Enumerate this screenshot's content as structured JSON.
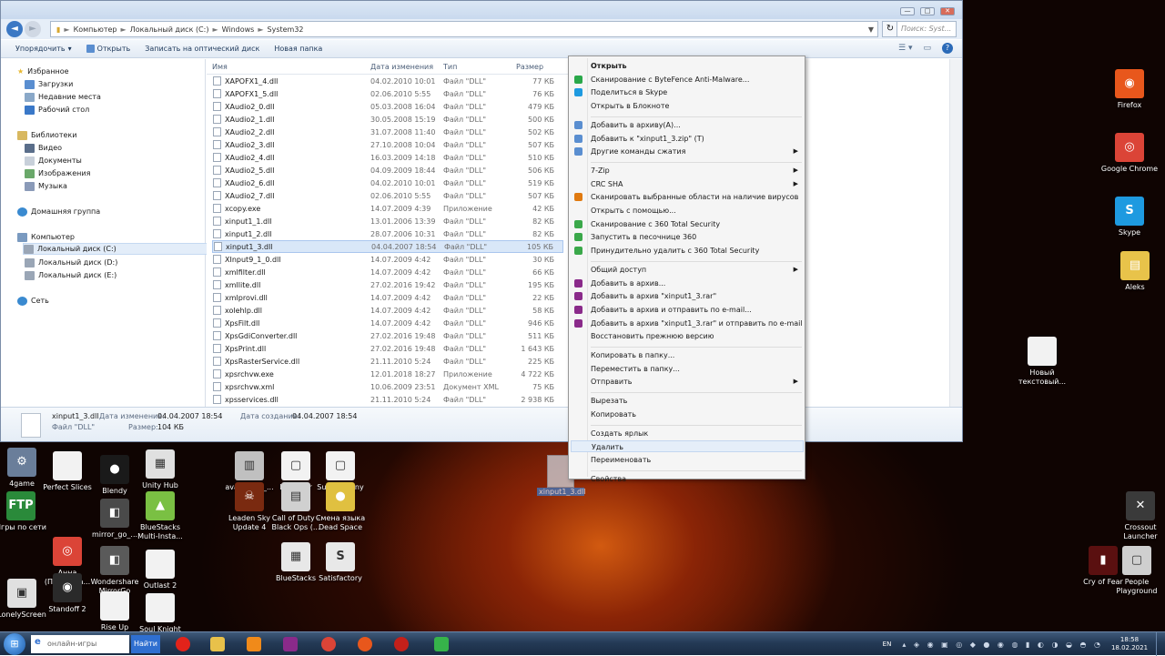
{
  "explorer": {
    "window_controls": {
      "minimize": "—",
      "maximize": "□",
      "close": "✕"
    },
    "breadcrumb": [
      "Компьютер",
      "Локальный диск (C:)",
      "Windows",
      "System32"
    ],
    "search_placeholder": "Поиск: Syst...",
    "toolbar": {
      "organize": "Упорядочить",
      "open": "Открыть",
      "burn": "Записать на оптический диск",
      "new_folder": "Новая папка"
    },
    "nav": {
      "favorites": "Избранное",
      "downloads": "Загрузки",
      "recent": "Недавние места",
      "desktop": "Рабочий стол",
      "libraries": "Библиотеки",
      "video": "Видео",
      "documents": "Документы",
      "images": "Изображения",
      "music": "Музыка",
      "homegroup": "Домашняя группа",
      "computer": "Компьютер",
      "drive_c": "Локальный диск (C:)",
      "drive_d": "Локальный диск (D:)",
      "drive_e": "Локальный диск (E:)",
      "network": "Сеть"
    },
    "columns": {
      "name": "Имя",
      "date": "Дата изменения",
      "type": "Тип",
      "size": "Размер"
    },
    "files": [
      {
        "name": "XAPOFX1_4.dll",
        "date": "04.02.2010 10:01",
        "type": "Файл \"DLL\"",
        "size": "77 КБ"
      },
      {
        "name": "XAPOFX1_5.dll",
        "date": "02.06.2010 5:55",
        "type": "Файл \"DLL\"",
        "size": "76 КБ"
      },
      {
        "name": "XAudio2_0.dll",
        "date": "05.03.2008 16:04",
        "type": "Файл \"DLL\"",
        "size": "479 КБ"
      },
      {
        "name": "XAudio2_1.dll",
        "date": "30.05.2008 15:19",
        "type": "Файл \"DLL\"",
        "size": "500 КБ"
      },
      {
        "name": "XAudio2_2.dll",
        "date": "31.07.2008 11:40",
        "type": "Файл \"DLL\"",
        "size": "502 КБ"
      },
      {
        "name": "XAudio2_3.dll",
        "date": "27.10.2008 10:04",
        "type": "Файл \"DLL\"",
        "size": "507 КБ"
      },
      {
        "name": "XAudio2_4.dll",
        "date": "16.03.2009 14:18",
        "type": "Файл \"DLL\"",
        "size": "510 КБ"
      },
      {
        "name": "XAudio2_5.dll",
        "date": "04.09.2009 18:44",
        "type": "Файл \"DLL\"",
        "size": "506 КБ"
      },
      {
        "name": "XAudio2_6.dll",
        "date": "04.02.2010 10:01",
        "type": "Файл \"DLL\"",
        "size": "519 КБ"
      },
      {
        "name": "XAudio2_7.dll",
        "date": "02.06.2010 5:55",
        "type": "Файл \"DLL\"",
        "size": "507 КБ"
      },
      {
        "name": "xcopy.exe",
        "date": "14.07.2009 4:39",
        "type": "Приложение",
        "size": "42 КБ"
      },
      {
        "name": "xinput1_1.dll",
        "date": "13.01.2006 13:39",
        "type": "Файл \"DLL\"",
        "size": "82 КБ"
      },
      {
        "name": "xinput1_2.dll",
        "date": "28.07.2006 10:31",
        "type": "Файл \"DLL\"",
        "size": "82 КБ"
      },
      {
        "name": "xinput1_3.dll",
        "date": "04.04.2007 18:54",
        "type": "Файл \"DLL\"",
        "size": "105 КБ",
        "selected": true
      },
      {
        "name": "XInput9_1_0.dll",
        "date": "14.07.2009 4:42",
        "type": "Файл \"DLL\"",
        "size": "30 КБ"
      },
      {
        "name": "xmlfilter.dll",
        "date": "14.07.2009 4:42",
        "type": "Файл \"DLL\"",
        "size": "66 КБ"
      },
      {
        "name": "xmllite.dll",
        "date": "27.02.2016 19:42",
        "type": "Файл \"DLL\"",
        "size": "195 КБ"
      },
      {
        "name": "xmlprovi.dll",
        "date": "14.07.2009 4:42",
        "type": "Файл \"DLL\"",
        "size": "22 КБ"
      },
      {
        "name": "xolehlp.dll",
        "date": "14.07.2009 4:42",
        "type": "Файл \"DLL\"",
        "size": "58 КБ"
      },
      {
        "name": "XpsFilt.dll",
        "date": "14.07.2009 4:42",
        "type": "Файл \"DLL\"",
        "size": "946 КБ"
      },
      {
        "name": "XpsGdiConverter.dll",
        "date": "27.02.2016 19:48",
        "type": "Файл \"DLL\"",
        "size": "511 КБ"
      },
      {
        "name": "XpsPrint.dll",
        "date": "27.02.2016 19:48",
        "type": "Файл \"DLL\"",
        "size": "1 643 КБ"
      },
      {
        "name": "XpsRasterService.dll",
        "date": "21.11.2010 5:24",
        "type": "Файл \"DLL\"",
        "size": "225 КБ"
      },
      {
        "name": "xpsrchvw.exe",
        "date": "12.01.2018 18:27",
        "type": "Приложение",
        "size": "4 722 КБ"
      },
      {
        "name": "xpsrchvw.xml",
        "date": "10.06.2009 23:51",
        "type": "Документ XML",
        "size": "75 КБ"
      },
      {
        "name": "xpsservices.dll",
        "date": "21.11.2010 5:24",
        "type": "Файл \"DLL\"",
        "size": "2 938 КБ"
      }
    ],
    "details": {
      "filename": "xinput1_3.dll",
      "filetype": "Файл \"DLL\"",
      "modified_label": "Дата изменения:",
      "modified_value": "04.04.2007 18:54",
      "size_label": "Размер:",
      "size_value": "104 КБ",
      "created_label": "Дата создания:",
      "created_value": "04.04.2007 18:54"
    }
  },
  "context_menu": [
    {
      "label": "Открыть",
      "bold": true
    },
    {
      "label": "Сканирование с ByteFence Anti-Malware...",
      "icon_color": "#2aa84a"
    },
    {
      "label": "Поделиться в Skype",
      "icon_color": "#1e9ae0"
    },
    {
      "label": "Открыть в Блокноте"
    },
    {
      "sep": true
    },
    {
      "label": "Добавить в архиву(A)...",
      "icon_color": "#5a8ed0"
    },
    {
      "label": "Добавить к \"xinput1_3.zip\" (T)",
      "icon_color": "#5a8ed0"
    },
    {
      "label": "Другие команды сжатия",
      "icon_color": "#5a8ed0",
      "submenu": true
    },
    {
      "sep": true
    },
    {
      "label": "7-Zip",
      "submenu": true
    },
    {
      "label": "CRC SHA",
      "submenu": true
    },
    {
      "label": "Сканировать выбранные области на наличие вирусов",
      "icon_color": "#e07a10"
    },
    {
      "label": "Открыть с помощью..."
    },
    {
      "label": "Сканирование с 360 Total Security",
      "icon_color": "#3aa84a"
    },
    {
      "label": "Запустить в песочнице 360",
      "icon_color": "#3aa84a"
    },
    {
      "label": "Принудительно удалить с 360 Total Security",
      "icon_color": "#3aa84a"
    },
    {
      "sep": true
    },
    {
      "label": "Общий доступ",
      "submenu": true
    },
    {
      "label": "Добавить в архив...",
      "icon_color": "#8a2a8a"
    },
    {
      "label": "Добавить в архив \"xinput1_3.rar\"",
      "icon_color": "#8a2a8a"
    },
    {
      "label": "Добавить в архив и отправить по e-mail...",
      "icon_color": "#8a2a8a"
    },
    {
      "label": "Добавить в архив \"xinput1_3.rar\" и отправить по e-mail",
      "icon_color": "#8a2a8a"
    },
    {
      "label": "Восстановить прежнюю версию"
    },
    {
      "sep": true
    },
    {
      "label": "Копировать в папку..."
    },
    {
      "label": "Переместить в папку..."
    },
    {
      "label": "Отправить",
      "submenu": true
    },
    {
      "sep": true
    },
    {
      "label": "Вырезать"
    },
    {
      "label": "Копировать"
    },
    {
      "sep": true
    },
    {
      "label": "Создать ярлык"
    },
    {
      "label": "Удалить",
      "highlighted": true
    },
    {
      "label": "Переименовать"
    },
    {
      "sep": true
    },
    {
      "label": "Свойства"
    }
  ],
  "drag_file_label": "xinput1_3.dll",
  "desktop_icons": [
    {
      "label": "Firefox",
      "color": "#e8571c",
      "glyph": "◉"
    },
    {
      "label": "Google Chrome",
      "color": "#db4437",
      "glyph": "◎"
    },
    {
      "label": "Skype",
      "color": "#1e9ae0",
      "glyph": "S"
    },
    {
      "label": "Aleks",
      "color": "#e8c34a",
      "glyph": "▤"
    },
    {
      "label": "Новый текстовый...",
      "color": "#f2f2f2",
      "glyph": ""
    },
    {
      "label": "Crossout Launcher",
      "color": "#3a3a3a",
      "glyph": "✕"
    },
    {
      "label": "Cry of Fear",
      "color": "#5a1010",
      "glyph": "▮"
    },
    {
      "label": "People Playground",
      "color": "#cfcfcf",
      "glyph": "▢"
    },
    {
      "label": "4game",
      "color": "#6a7e9a",
      "glyph": "⚙"
    },
    {
      "label": "Perfect Slices",
      "color": "#f2f2f2",
      "glyph": ""
    },
    {
      "label": "Unity Hub",
      "color": "#e0e0e0",
      "glyph": "▦"
    },
    {
      "label": "Blendy",
      "color": "#1a1a1a",
      "glyph": "●"
    },
    {
      "label": "avast_free_...",
      "color": "#c0c0c0",
      "glyph": "▥"
    },
    {
      "label": "LDPlayer",
      "color": "#f2f2f2",
      "glyph": "▢"
    },
    {
      "label": "Super Bunny man",
      "color": "#f2f2f2",
      "glyph": "▢"
    },
    {
      "label": "Игры по сети",
      "color": "#2a8a3a",
      "glyph": "FTP"
    },
    {
      "label": "mirror_go_...",
      "color": "#4a4a4a",
      "glyph": "◧"
    },
    {
      "label": "BlueStacks Multi-Insta...",
      "color": "#7ac043",
      "glyph": "▲"
    },
    {
      "label": "Leaden Sky Update 4",
      "color": "#7a2a10",
      "glyph": "☠"
    },
    {
      "label": "Call of Duty - Black Ops (...",
      "color": "#d0d0d0",
      "glyph": "▤"
    },
    {
      "label": "Смена языка Dead Space",
      "color": "#e0c040",
      "glyph": "●"
    },
    {
      "label": "Анна (Пользова...",
      "color": "#db4437",
      "glyph": "◎"
    },
    {
      "label": "Wondershare MirrorGo",
      "color": "#5a5a5a",
      "glyph": "◧"
    },
    {
      "label": "Outlast 2",
      "color": "#f2f2f2",
      "glyph": ""
    },
    {
      "label": "BlueStacks",
      "color": "#e8e8e8",
      "glyph": "▦"
    },
    {
      "label": "Satisfactory",
      "color": "#e8e8e8",
      "glyph": "S"
    },
    {
      "label": "LonelyScreen",
      "color": "#e0e0e0",
      "glyph": "▣"
    },
    {
      "label": "Standoff 2",
      "color": "#2a2a2a",
      "glyph": "◉"
    },
    {
      "label": "Rise Up",
      "color": "#f2f2f2",
      "glyph": ""
    },
    {
      "label": "Soul Knight",
      "color": "#f2f2f2",
      "glyph": ""
    }
  ],
  "taskbar": {
    "search_placeholder": "онлайн-игры",
    "search_button": "Найти",
    "apps": [
      {
        "name": "opera",
        "color": "#e2231a"
      },
      {
        "name": "explorer",
        "color": "#e8c14a"
      },
      {
        "name": "media-player",
        "color": "#f08a1a"
      },
      {
        "name": "winrar",
        "color": "#8a2a8a"
      },
      {
        "name": "chrome",
        "color": "#db4437"
      },
      {
        "name": "firefox",
        "color": "#e8571c"
      },
      {
        "name": "opera-alt",
        "color": "#c4201a"
      },
      {
        "name": "utorrent",
        "color": "#36b34a"
      }
    ],
    "lang": "EN",
    "time": "18:58",
    "date": "18.02.2021"
  }
}
